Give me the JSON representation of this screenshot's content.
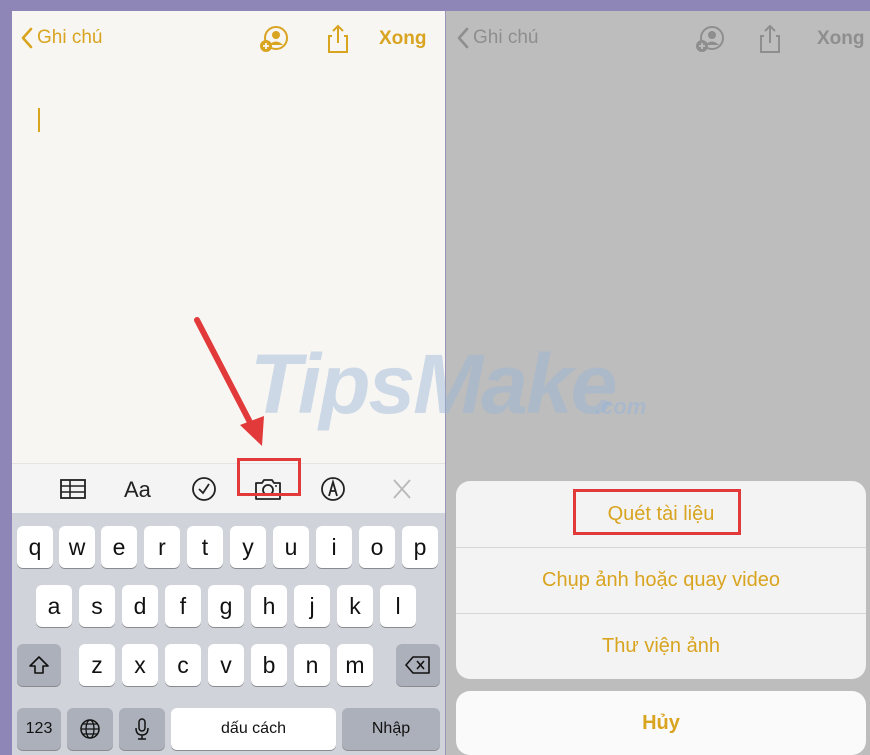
{
  "left_screen": {
    "nav": {
      "back_label": "Ghi chú",
      "done_label": "Xong"
    },
    "toolbar": {
      "format_label": "Aa"
    },
    "keyboard": {
      "row1": [
        "q",
        "w",
        "e",
        "r",
        "t",
        "y",
        "u",
        "i",
        "o",
        "p"
      ],
      "row2": [
        "a",
        "s",
        "d",
        "f",
        "g",
        "h",
        "j",
        "k",
        "l"
      ],
      "row3": [
        "z",
        "x",
        "c",
        "v",
        "b",
        "n",
        "m"
      ],
      "numbers_label": "123",
      "space_label": "dấu cách",
      "return_label": "Nhập"
    }
  },
  "right_screen": {
    "nav": {
      "back_label": "Ghi chú",
      "done_label": "Xong"
    },
    "action_sheet": {
      "items": [
        "Quét tài liệu",
        "Chụp ảnh hoặc quay video",
        "Thư viện ảnh"
      ],
      "cancel_label": "Hủy"
    }
  },
  "watermark": {
    "text": "TipsMake",
    "suffix": ".com"
  },
  "colors": {
    "accent": "#d9a420",
    "highlight_box": "#e23a3a",
    "arrow": "#e23a3a"
  }
}
